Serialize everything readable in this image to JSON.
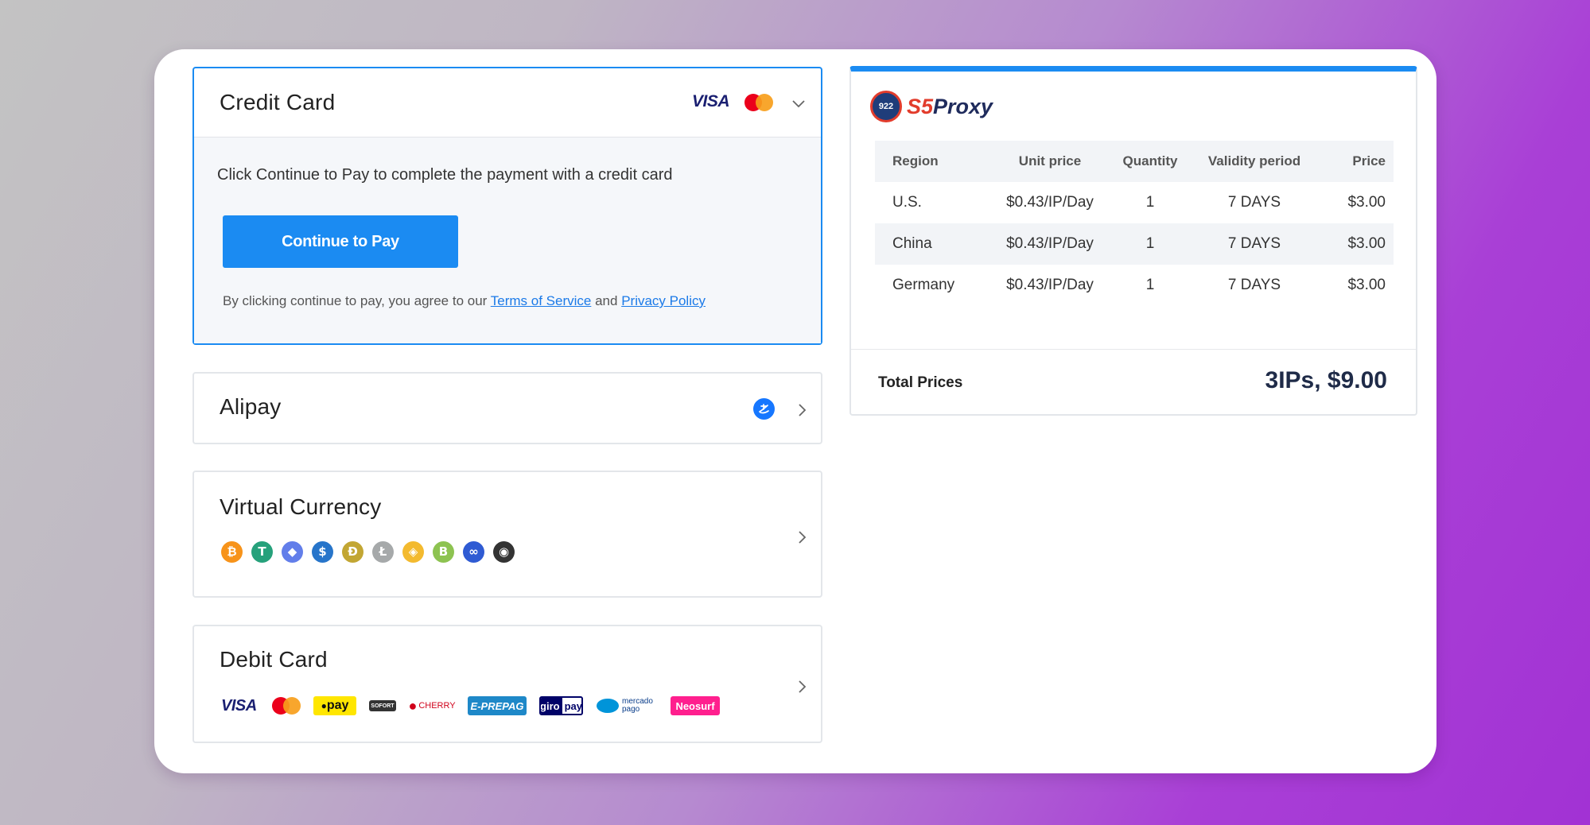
{
  "payment_methods": {
    "credit_card": {
      "title": "Credit Card",
      "visa": "VISA",
      "description": "Click Continue to Pay to complete the payment with a credit card",
      "button": "Continue to Pay",
      "agree_prefix": "By clicking continue to pay, you agree to our",
      "terms": "Terms of Service",
      "and": "and",
      "privacy": "Privacy Policy"
    },
    "alipay": {
      "title": "Alipay"
    },
    "virtual_currency": {
      "title": "Virtual Currency",
      "coins": [
        {
          "name": "bitcoin-icon",
          "glyph": "₿",
          "color": "#f7931a"
        },
        {
          "name": "tether-icon",
          "glyph": "T",
          "color": "#26a17b"
        },
        {
          "name": "ethereum-icon",
          "glyph": "◆",
          "color": "#627eea"
        },
        {
          "name": "usdc-icon",
          "glyph": "$",
          "color": "#2775ca"
        },
        {
          "name": "dogecoin-icon",
          "glyph": "Đ",
          "color": "#c2a633"
        },
        {
          "name": "litecoin-icon",
          "glyph": "Ł",
          "color": "#a6a9aa"
        },
        {
          "name": "bnb-icon",
          "glyph": "◈",
          "color": "#f3ba2f"
        },
        {
          "name": "bitcoin-cash-icon",
          "glyph": "B",
          "color": "#8dc351"
        },
        {
          "name": "polygon-icon",
          "glyph": "∞",
          "color": "#2f5bd3"
        },
        {
          "name": "shiba-icon",
          "glyph": "◉",
          "color": "#333333"
        }
      ]
    },
    "debit_card": {
      "title": "Debit Card",
      "visa": "VISA",
      "pay_logo": "pay",
      "sofort": "SOFORT",
      "cherry": "CHERRY",
      "eprepag": "E-PREPAG",
      "giro": "giro",
      "giropay": "pay",
      "mercado": "mercado pago",
      "neosurf": "Neosurf"
    }
  },
  "summary": {
    "brand_prefix": "S5",
    "brand_suffix": "Proxy",
    "globe_text": "922",
    "columns": [
      "Region",
      "Unit price",
      "Quantity",
      "Validity period",
      "Price"
    ],
    "rows": [
      [
        "U.S.",
        "$0.43/IP/Day",
        "1",
        "7 DAYS",
        "$3.00"
      ],
      [
        "China",
        "$0.43/IP/Day",
        "1",
        "7 DAYS",
        "$3.00"
      ],
      [
        "Germany",
        "$0.43/IP/Day",
        "1",
        "7 DAYS",
        "$3.00"
      ]
    ],
    "total_label": "Total Prices",
    "total_value": "3IPs, $9.00"
  },
  "colors": {
    "accent": "#1b8bf2",
    "brand_red": "#e23c2c",
    "brand_navy": "#1f2b5c"
  }
}
